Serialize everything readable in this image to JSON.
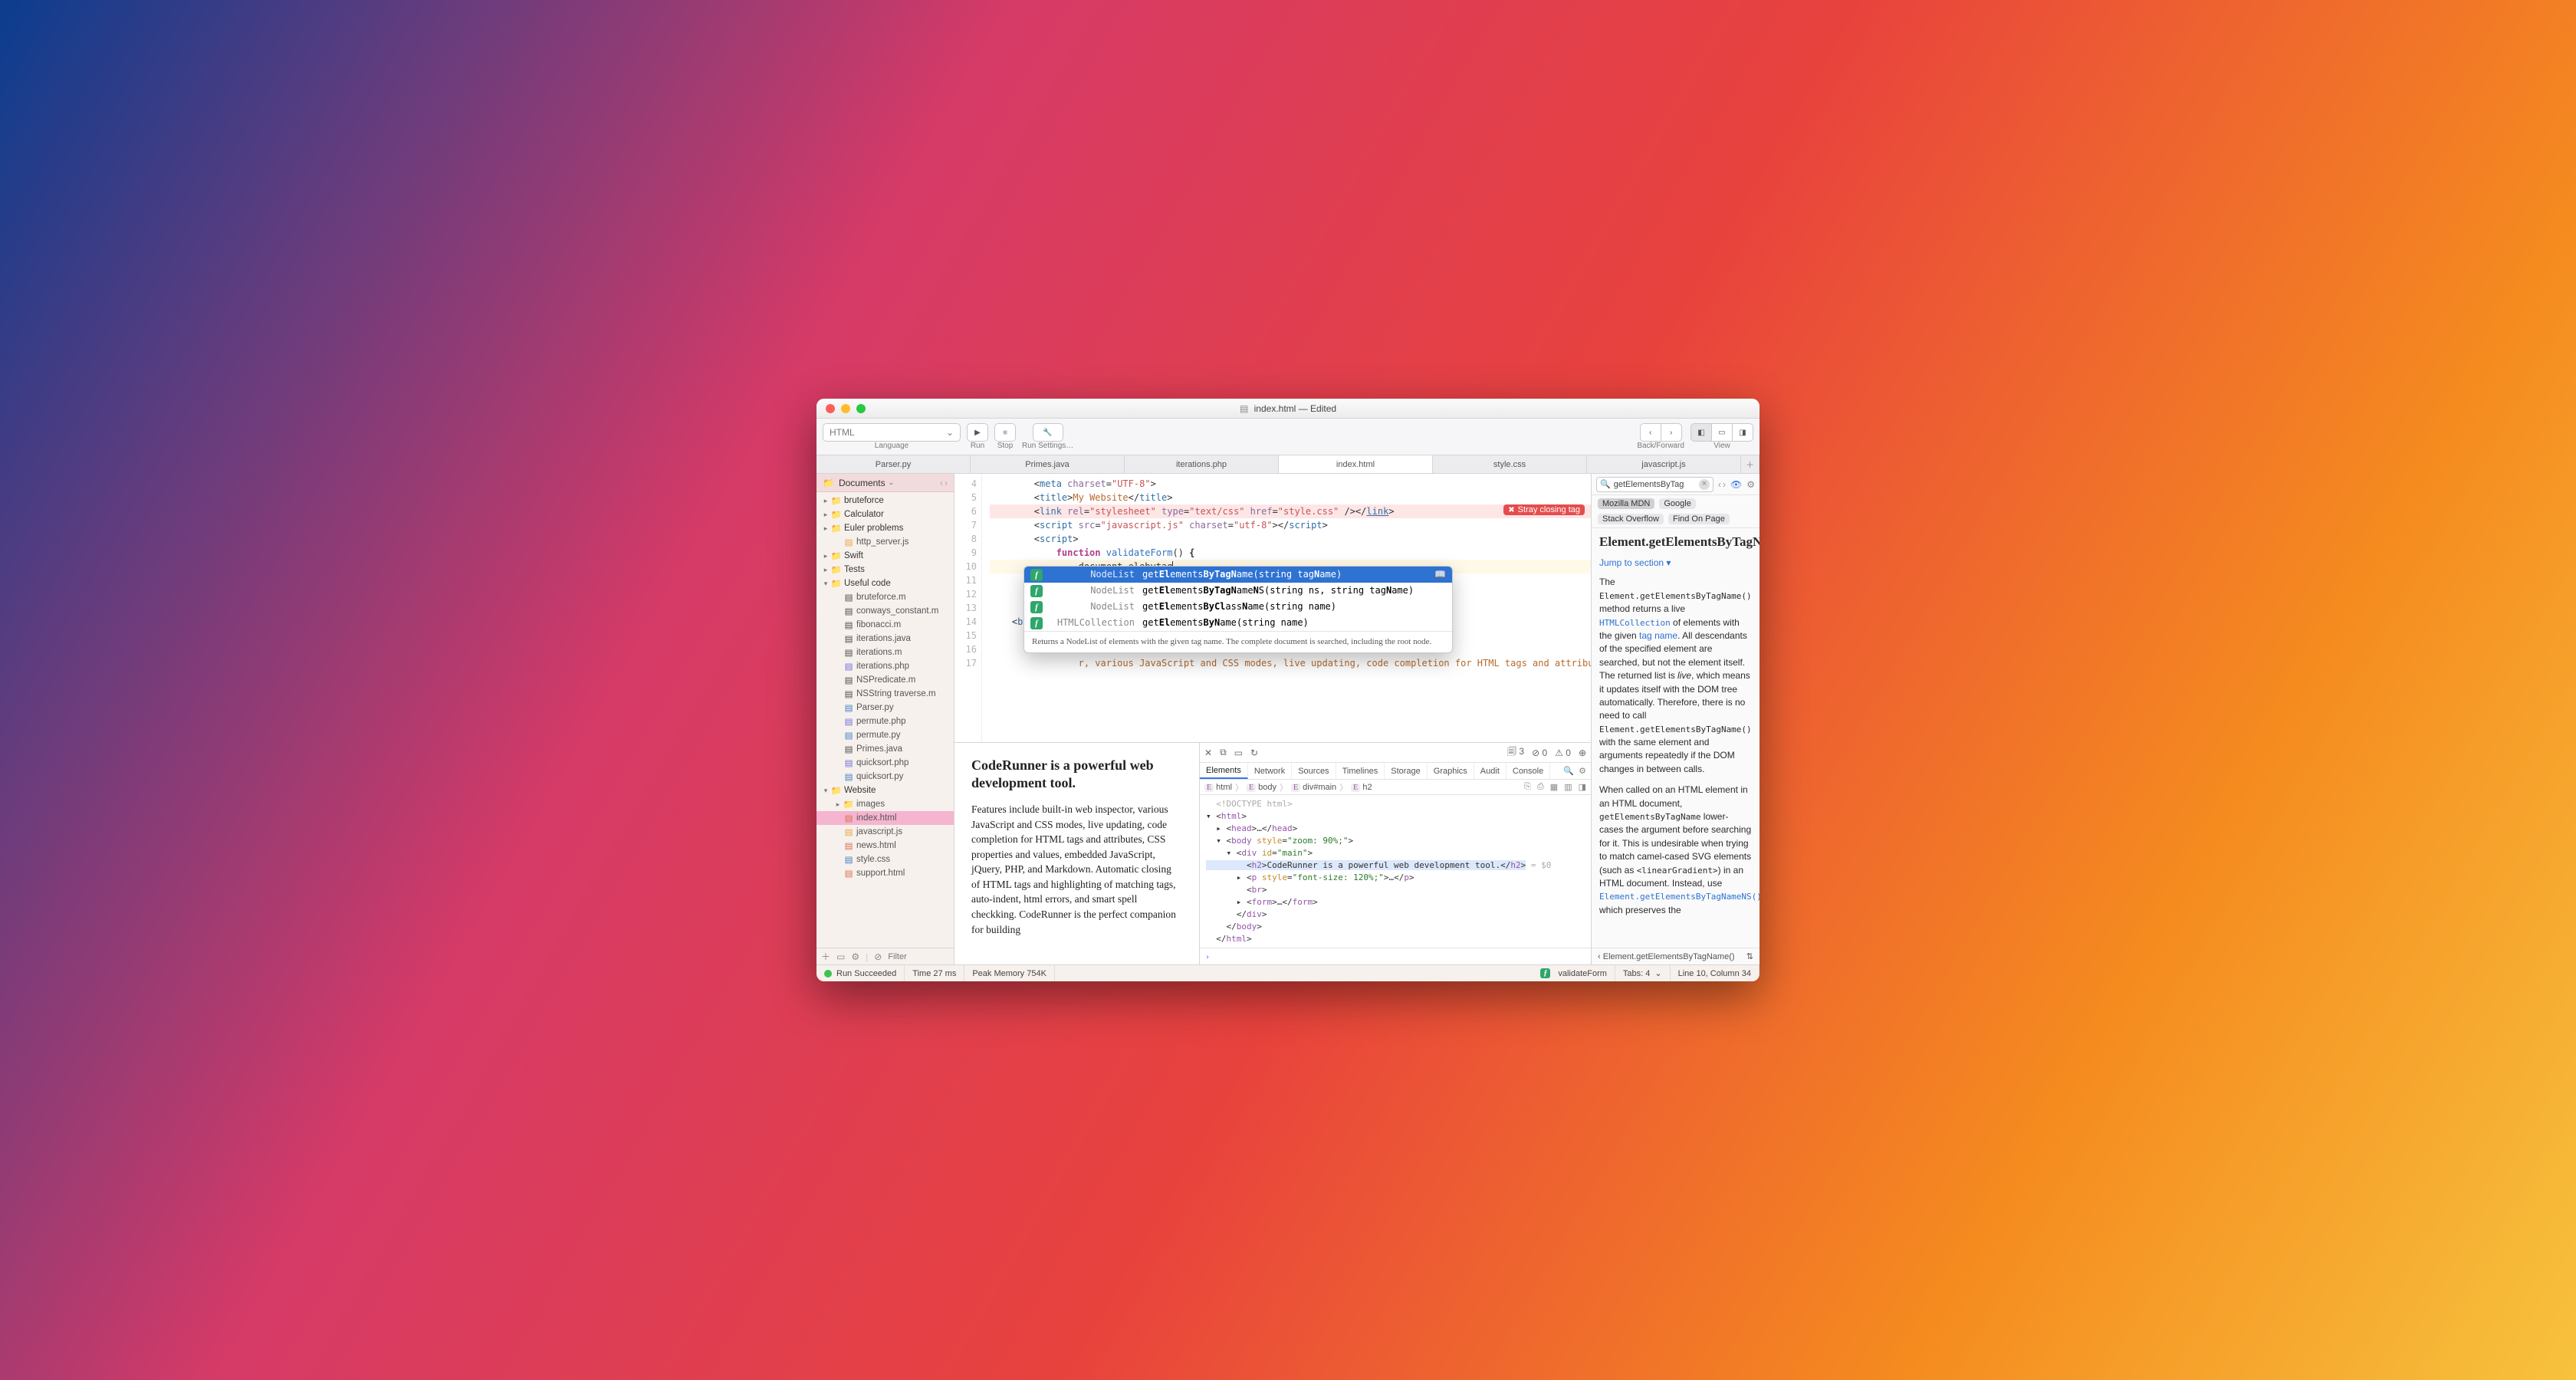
{
  "title": {
    "filename": "index.html",
    "suffix": "— Edited"
  },
  "toolbar": {
    "language": "HTML",
    "language_label": "Language",
    "run": "Run",
    "stop": "Stop",
    "settings": "Run Settings…",
    "backforward": "Back/Forward",
    "view": "View"
  },
  "tabs": [
    "Parser.py",
    "Primes.java",
    "iterations.php",
    "index.html",
    "style.css",
    "javascript.js"
  ],
  "active_tab": 3,
  "sidebar": {
    "root": "Documents",
    "items": [
      {
        "type": "folder",
        "name": "bruteforce",
        "depth": 0,
        "open": false
      },
      {
        "type": "folder",
        "name": "Calculator",
        "depth": 0,
        "open": false
      },
      {
        "type": "folder",
        "name": "Euler problems",
        "depth": 0,
        "open": false
      },
      {
        "type": "file",
        "ext": "js",
        "name": "http_server.js",
        "depth": 1
      },
      {
        "type": "folder",
        "name": "Swift",
        "depth": 0,
        "open": false
      },
      {
        "type": "folder",
        "name": "Tests",
        "depth": 0,
        "open": false
      },
      {
        "type": "folder",
        "name": "Useful code",
        "depth": 0,
        "open": true
      },
      {
        "type": "file",
        "ext": "m",
        "name": "bruteforce.m",
        "depth": 1
      },
      {
        "type": "file",
        "ext": "m",
        "name": "conways_constant.m",
        "depth": 1
      },
      {
        "type": "file",
        "ext": "m",
        "name": "fibonacci.m",
        "depth": 1
      },
      {
        "type": "file",
        "ext": "java",
        "name": "iterations.java",
        "depth": 1
      },
      {
        "type": "file",
        "ext": "m",
        "name": "iterations.m",
        "depth": 1
      },
      {
        "type": "file",
        "ext": "php",
        "name": "iterations.php",
        "depth": 1
      },
      {
        "type": "file",
        "ext": "m",
        "name": "NSPredicate.m",
        "depth": 1
      },
      {
        "type": "file",
        "ext": "m",
        "name": "NSString traverse.m",
        "depth": 1
      },
      {
        "type": "file",
        "ext": "py",
        "name": "Parser.py",
        "depth": 1
      },
      {
        "type": "file",
        "ext": "php",
        "name": "permute.php",
        "depth": 1
      },
      {
        "type": "file",
        "ext": "py",
        "name": "permute.py",
        "depth": 1
      },
      {
        "type": "file",
        "ext": "java",
        "name": "Primes.java",
        "depth": 1
      },
      {
        "type": "file",
        "ext": "php",
        "name": "quicksort.php",
        "depth": 1
      },
      {
        "type": "file",
        "ext": "py",
        "name": "quicksort.py",
        "depth": 1
      },
      {
        "type": "folder",
        "name": "Website",
        "depth": 0,
        "open": true
      },
      {
        "type": "folder",
        "name": "images",
        "depth": 1,
        "open": false
      },
      {
        "type": "file",
        "ext": "html",
        "name": "index.html",
        "depth": 1,
        "selected": true
      },
      {
        "type": "file",
        "ext": "js",
        "name": "javascript.js",
        "depth": 1
      },
      {
        "type": "file",
        "ext": "html",
        "name": "news.html",
        "depth": 1
      },
      {
        "type": "file",
        "ext": "css",
        "name": "style.css",
        "depth": 1
      },
      {
        "type": "file",
        "ext": "html",
        "name": "support.html",
        "depth": 1
      }
    ],
    "filter_placeholder": "Filter"
  },
  "editor": {
    "first_line_no": 4,
    "error_badge": "Stray closing tag",
    "cursor_line_text": "document.elebytag",
    "body_text_tail": "r, various JavaScript and CSS modes, live updating, code completion for HTML tags and attributes, CSS properties and values, embedded JavaScript, jQuery, PHP, and Markdown. Automatic closing of HTML tags and highlighting of matching tags, auto-indent, html errors, and smart spell checkking. CodeRunner is the perfect companion for building great websites."
  },
  "autocomplete": {
    "items": [
      {
        "ret": "NodeList",
        "sig": "getElementsByTagName(string tagName)",
        "sel": true
      },
      {
        "ret": "NodeList",
        "sig": "getElementsByTagNameNS(string ns, string tagName)"
      },
      {
        "ret": "NodeList",
        "sig": "getElementsByClassName(string name)"
      },
      {
        "ret": "HTMLCollection",
        "sig": "getElementsByName(string name)"
      }
    ],
    "desc": "Returns a NodeList of elements with the given tag name. The complete document is searched, including the root node."
  },
  "preview": {
    "heading": "CodeRunner is a powerful web development tool.",
    "para": "Features include built-in web inspector, various JavaScript and CSS modes, live updating, code completion for HTML tags and attributes, CSS properties and values, embedded JavaScript, jQuery, PHP, and Markdown. Automatic closing of HTML tags and highlighting of matching tags, auto-indent, html errors, and smart spell checkking. CodeRunner is the perfect companion for building"
  },
  "devtools": {
    "resource_count": "3",
    "err_count": "0",
    "warn_count": "0",
    "tabs": [
      "Elements",
      "Network",
      "Sources",
      "Timelines",
      "Storage",
      "Graphics",
      "Audit",
      "Console"
    ],
    "crumbs": [
      "html",
      "body",
      "div#main",
      "h2"
    ],
    "dom_h2_text": "CodeRunner is a powerful web development tool.",
    "selected_suffix": "= $0"
  },
  "doc": {
    "search_value": "getElementsByTag",
    "sources": [
      "Mozilla MDN",
      "Google",
      "Stack Overflow",
      "Find On Page"
    ],
    "title": "Element.getElementsByTagName()",
    "jump": "Jump to section ▾",
    "para1_a": "The ",
    "para1_code1": "Element.getElementsByTagName()",
    "para1_b": " method returns a live ",
    "para1_link1": "HTMLCollection",
    "para1_c": " of elements with the given ",
    "para1_link2": "tag name",
    "para1_d": ". All descendants of the specified element are searched, but not the element itself. The returned list is ",
    "para1_em": "live",
    "para1_e": ", which means it updates itself with the DOM tree automatically. Therefore, there is no need to call ",
    "para1_code2": "Element.getElementsByTagName()",
    "para1_f": " with the same element and arguments repeatedly if the DOM changes in between calls.",
    "para2_a": "When called on an HTML element in an HTML document, ",
    "para2_code1": "getElementsByTagName",
    "para2_b": " lower-cases the argument before searching for it. This is undesirable when trying to match camel-cased SVG elements (such as ",
    "para2_code2": "<linearGradient>",
    "para2_c": ") in an HTML document. Instead, use ",
    "para2_link": "Element.getElementsByTagNameNS()",
    "para2_d": " which preserves the",
    "crumb": "Element.getElementsByTagName()"
  },
  "status": {
    "run": "Run Succeeded",
    "time": "Time 27 ms",
    "mem": "Peak Memory 754K",
    "fn": "validateForm",
    "tabs": "Tabs: 4",
    "pos": "Line 10, Column 34"
  }
}
